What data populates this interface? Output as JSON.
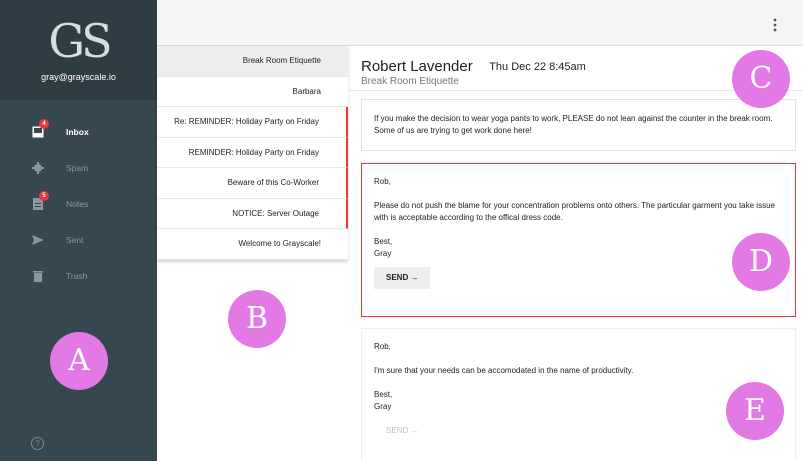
{
  "sidebar": {
    "logo": "GS",
    "account": "gray@grayscale.io",
    "items": [
      {
        "label": "Inbox",
        "icon": "inbox-icon",
        "badge": "4",
        "active": true
      },
      {
        "label": "Spam",
        "icon": "spam-icon",
        "badge": "",
        "active": false
      },
      {
        "label": "Notes",
        "icon": "notes-icon",
        "badge": "5",
        "active": false
      },
      {
        "label": "Sent",
        "icon": "send-icon",
        "badge": "",
        "active": false
      },
      {
        "label": "Trash",
        "icon": "trash-icon",
        "badge": "",
        "active": false
      }
    ],
    "help_glyph": "?"
  },
  "threads": [
    {
      "subject": "Break Room Etiquette"
    },
    {
      "subject": "Barbara"
    },
    {
      "subject": "Re: REMINDER: Holiday Party on Friday"
    },
    {
      "subject": "REMINDER: Holiday Party on Friday"
    },
    {
      "subject": "Beware of this Co-Worker"
    },
    {
      "subject": "NOTICE: Server Outage"
    },
    {
      "subject": "Welcome to Grayscale!"
    }
  ],
  "message": {
    "sender": "Robert Lavender",
    "date": "Thu Dec 22 8:45am",
    "subject": "Break Room Etiquette",
    "body": "If you make the decision to wear yoga pants to work, PLEASE do not lean against the counter in the break room. Some of us are trying to get work done here!"
  },
  "drafts": [
    {
      "greeting": "Rob,",
      "body": "Please do not push the blame for your concentration problems onto others. The particular garment you take issue with is acceptable according to the offical dress code.",
      "signoff": "Best,",
      "signature": "Gray",
      "send_label": "SEND →"
    },
    {
      "greeting": "Rob,",
      "body": "I'm sure that your needs can be accomodated in the name of productivity.",
      "signoff": "Best,",
      "signature": "Gray",
      "send_label": "SEND →"
    }
  ],
  "markers": [
    "A",
    "B",
    "C",
    "D",
    "E"
  ],
  "colors": {
    "sidebar": "#37474f",
    "sidebar_header": "#2e3c43",
    "badge": "#e53935",
    "selected_border": "#e53935",
    "marker": "#e279e4"
  }
}
